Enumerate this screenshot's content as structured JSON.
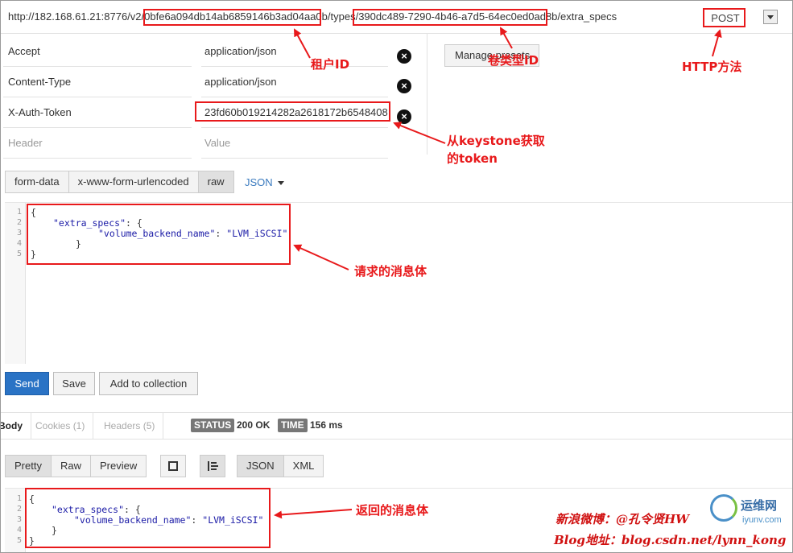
{
  "request": {
    "url_prefix": "http://182.168.61.21:8776/v2/",
    "tenant_id": "0bfe6a094db14ab6859146b3ad04aa0b",
    "url_types": "/types/",
    "volume_type_id": "390dc489-7290-4b46-a7d5-64ec0ed0ad8b",
    "url_suffix": "/extra_specs",
    "method": "POST"
  },
  "headers": [
    {
      "key": "Accept",
      "value": "application/json"
    },
    {
      "key": "Content-Type",
      "value": "application/json"
    },
    {
      "key": "X-Auth-Token",
      "value": "23fd60b019214282a2618172b6548408"
    }
  ],
  "header_placeholders": {
    "key": "Header",
    "value": "Value"
  },
  "manage_button": "Manage presets",
  "body_modes": [
    "form-data",
    "x-www-form-urlencoded",
    "raw"
  ],
  "body_format": "JSON",
  "request_body": {
    "line_numbers": [
      "1",
      "2",
      "3",
      "4",
      "5"
    ],
    "line1": "{",
    "line2_key": "\"extra_specs\"",
    "line2_rest": ": {",
    "line3_key": "\"volume_backend_name\"",
    "line3_sep": ": ",
    "line3_val": "\"LVM_iSCSI\"",
    "line4": "}",
    "line5": "}"
  },
  "actions": {
    "send": "Send",
    "save": "Save",
    "add_to_collection": "Add to collection"
  },
  "response": {
    "tabs": [
      "Body",
      "Cookies (1)",
      "Headers (5)"
    ],
    "status_label": "STATUS",
    "status_value": "200 OK",
    "time_label": "TIME",
    "time_value": "156 ms",
    "view_modes": [
      "Pretty",
      "Raw",
      "Preview"
    ],
    "formats": [
      "JSON",
      "XML"
    ]
  },
  "response_body": {
    "line_numbers": [
      "1",
      "2",
      "3",
      "4",
      "5"
    ],
    "line1": "{",
    "line2_key": "\"extra_specs\"",
    "line2_rest": ": {",
    "line3_key": "\"volume_backend_name\"",
    "line3_sep": ": ",
    "line3_val": "\"LVM_iSCSI\"",
    "line4": "}",
    "line5": "}"
  },
  "annotations": {
    "tenant_id": "租户ID",
    "volume_type_id": "卷类型ID",
    "http_method": "HTTP方法",
    "token_line1": "从keystone获取",
    "token_line2": "的token",
    "request_body": "请求的消息体",
    "response_body": "返回的消息体",
    "watermark_line1": "新浪微博：@孔令贤HW",
    "watermark_line2": "Blog地址：blog.csdn.net/lynn_kong",
    "logo": "运维网",
    "logo_sub": "iyunv.com"
  },
  "colors": {
    "accent": "#2a73c5",
    "annotation": "#e8191b",
    "badge": "#777777"
  }
}
